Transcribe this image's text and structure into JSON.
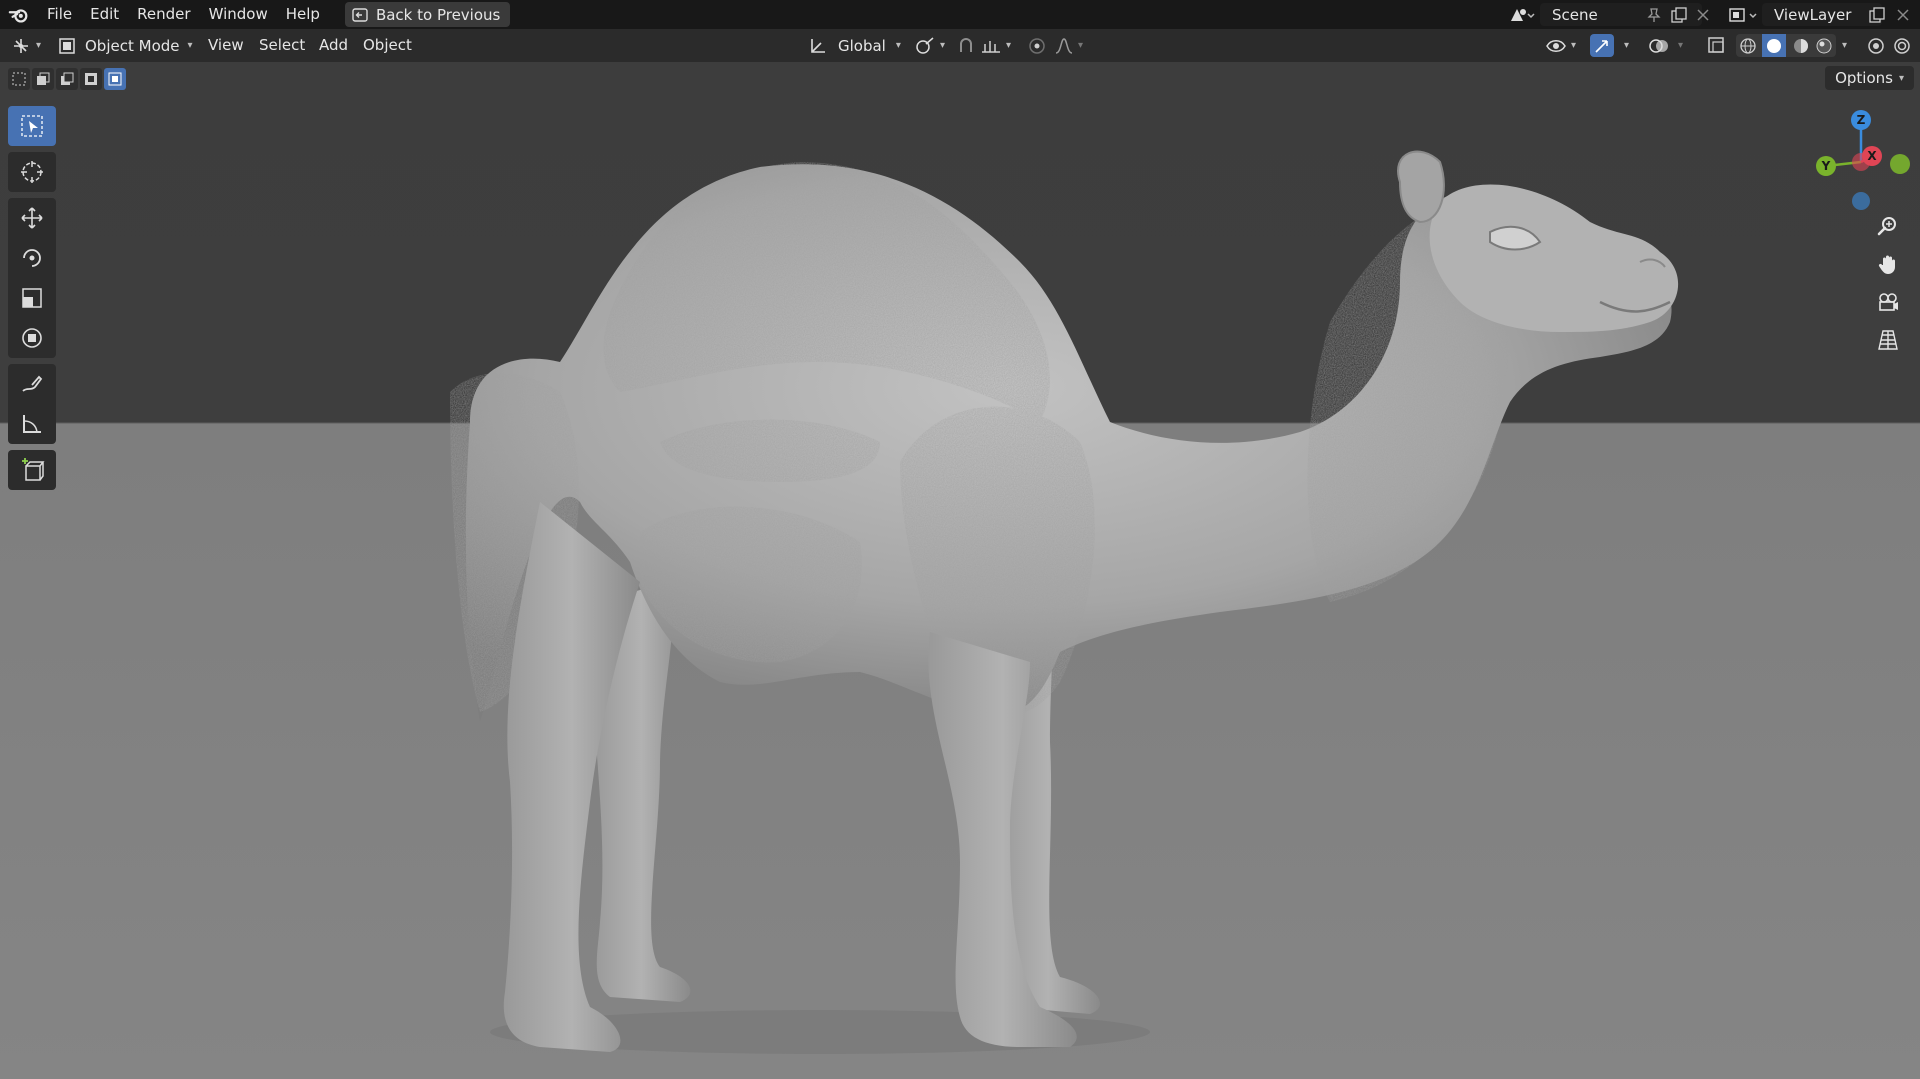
{
  "topbar": {
    "menus": [
      "File",
      "Edit",
      "Render",
      "Window",
      "Help"
    ],
    "back_button": "Back to Previous",
    "scene_name": "Scene",
    "view_layer": "ViewLayer"
  },
  "header": {
    "mode": "Object Mode",
    "menus": [
      "View",
      "Select",
      "Add",
      "Object"
    ],
    "transform_orientation": "Global"
  },
  "viewport": {
    "options_label": "Options",
    "gizmo_axes": {
      "z": "Z",
      "y": "Y",
      "x": "X"
    },
    "object": "camel sculpt with fur"
  },
  "colors": {
    "accent": "#4772b3",
    "axis_x": "#e04555",
    "axis_y": "#7ab32c",
    "axis_z": "#3a8cde"
  }
}
